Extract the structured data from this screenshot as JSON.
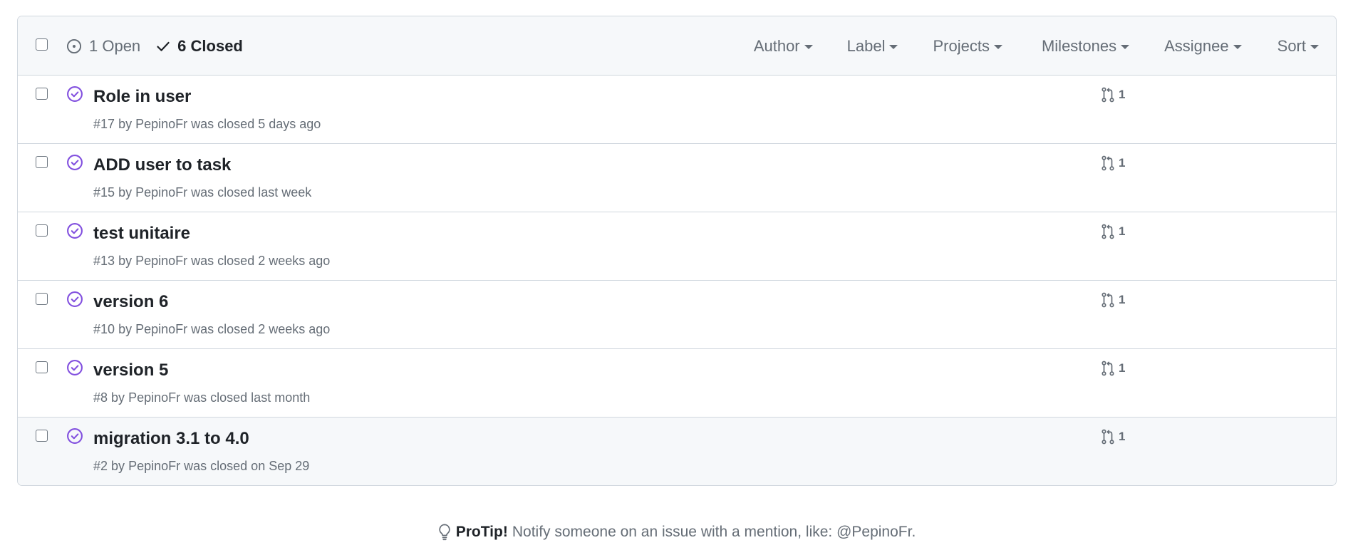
{
  "header": {
    "open_count_label": "1 Open",
    "closed_count_label": "6 Closed",
    "filters": [
      {
        "label": "Author",
        "icon": "triangle-down-icon"
      },
      {
        "label": "Label",
        "icon": "triangle-down-icon"
      },
      {
        "label": "Projects",
        "icon": "triangle-down-icon"
      },
      {
        "label": "Milestones",
        "icon": "triangle-down-icon"
      },
      {
        "label": "Assignee",
        "icon": "triangle-down-icon"
      },
      {
        "label": "Sort",
        "icon": "triangle-down-icon"
      }
    ]
  },
  "issues": [
    {
      "title": "Role in user",
      "number": "#17",
      "by": "by",
      "author": "PepinoFr",
      "status_text": "was closed 5 days ago",
      "linked_prs": "1"
    },
    {
      "title": "ADD user to task",
      "number": "#15",
      "by": "by",
      "author": "PepinoFr",
      "status_text": "was closed last week",
      "linked_prs": "1"
    },
    {
      "title": "test unitaire",
      "number": "#13",
      "by": "by",
      "author": "PepinoFr",
      "status_text": "was closed 2 weeks ago",
      "linked_prs": "1"
    },
    {
      "title": "version 6",
      "number": "#10",
      "by": "by",
      "author": "PepinoFr",
      "status_text": "was closed 2 weeks ago",
      "linked_prs": "1"
    },
    {
      "title": "version 5",
      "number": "#8",
      "by": "by",
      "author": "PepinoFr",
      "status_text": "was closed last month",
      "linked_prs": "1"
    },
    {
      "title": "migration 3.1 to 4.0",
      "number": "#2",
      "by": "by",
      "author": "PepinoFr",
      "status_text": "was closed on Sep 29",
      "linked_prs": "1"
    }
  ],
  "protip": {
    "label": "ProTip!",
    "text": "Notify someone on an issue with a mention, like: @PepinoFr.",
    "icon": "light-bulb-icon"
  },
  "colors": {
    "closed_purple": "#8250df",
    "muted": "#656d76",
    "border": "#d0d7de",
    "header_bg": "#f6f8fa"
  }
}
